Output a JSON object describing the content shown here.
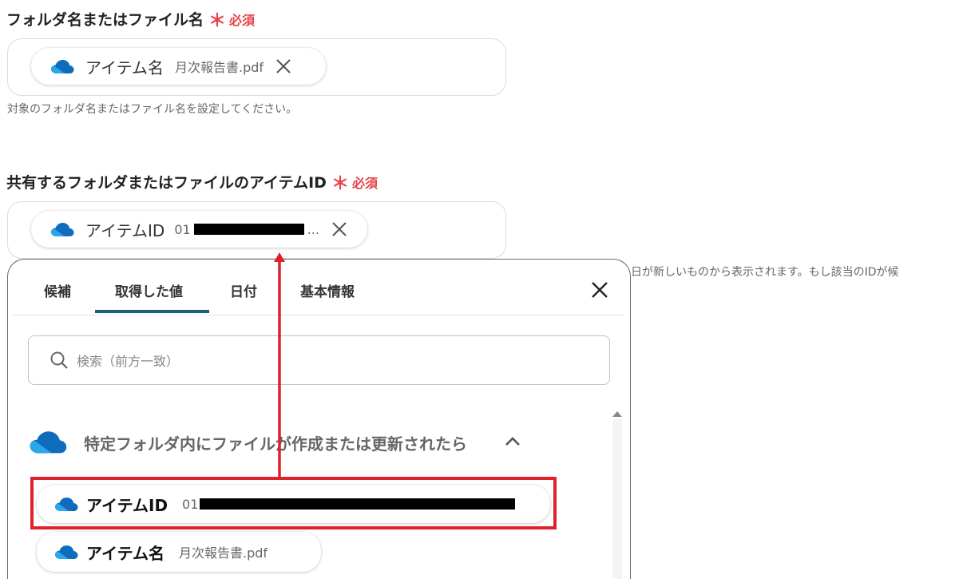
{
  "field1": {
    "label": "フォルダ名またはファイル名",
    "required_star": "＊",
    "required_text": "必須",
    "chip": {
      "name": "アイテム名",
      "value": "月次報告書.pdf"
    },
    "help": "対象のフォルダ名またはファイル名を設定してください。"
  },
  "field2": {
    "label": "共有するフォルダまたはファイルのアイテムID",
    "required_star": "＊",
    "required_text": "必須",
    "chip": {
      "name": "アイテムID",
      "value_prefix": "01",
      "value_suffix": "..."
    },
    "help_partial": "日が新しいものから表示されます。もし該当のIDが候"
  },
  "popup": {
    "tabs": [
      {
        "label": "候補"
      },
      {
        "label": "取得した値",
        "active": true
      },
      {
        "label": "日付"
      },
      {
        "label": "基本情報"
      }
    ],
    "search_placeholder": "検索（前方一致）",
    "group_title": "特定フォルダ内にファイルが作成または更新されたら",
    "items": [
      {
        "name": "アイテムID",
        "value_prefix": "01"
      },
      {
        "name": "アイテム名",
        "value": "月次報告書.pdf"
      }
    ]
  },
  "colors": {
    "accent_tab": "#1a5f7a",
    "required": "#e8414b",
    "annotation": "#e0202a",
    "cloud": "#1e78d0"
  },
  "icons": [
    "onedrive-cloud-icon",
    "close-icon",
    "search-icon",
    "chevron-up-icon",
    "scroll-up-arrow-icon"
  ]
}
